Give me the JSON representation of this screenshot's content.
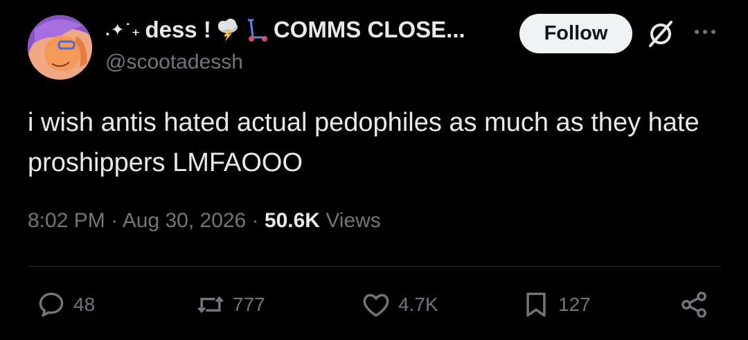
{
  "author": {
    "display_name": "dess !",
    "name_prefix": ".✦˙₊",
    "name_suffix": "COMMS CLOSE...",
    "handle": "@scootadessh",
    "avatar_icon": "avatar-icon"
  },
  "follow_label": "Follow",
  "tweet": {
    "text": "i wish antis hated actual pedophiles as much as they hate proshippers LMFAOOO",
    "time": "8:02 PM",
    "date": "Aug 30, 2026",
    "views_count": "50.6K",
    "views_label": "Views"
  },
  "actions": {
    "replies": "48",
    "reposts": "777",
    "likes": "4.7K",
    "bookmarks": "127"
  },
  "colors": {
    "background": "#000000",
    "text": "#e7e9ea",
    "secondary": "#71767b",
    "divider": "#2f3336",
    "follow_bg": "#eff3f4"
  }
}
